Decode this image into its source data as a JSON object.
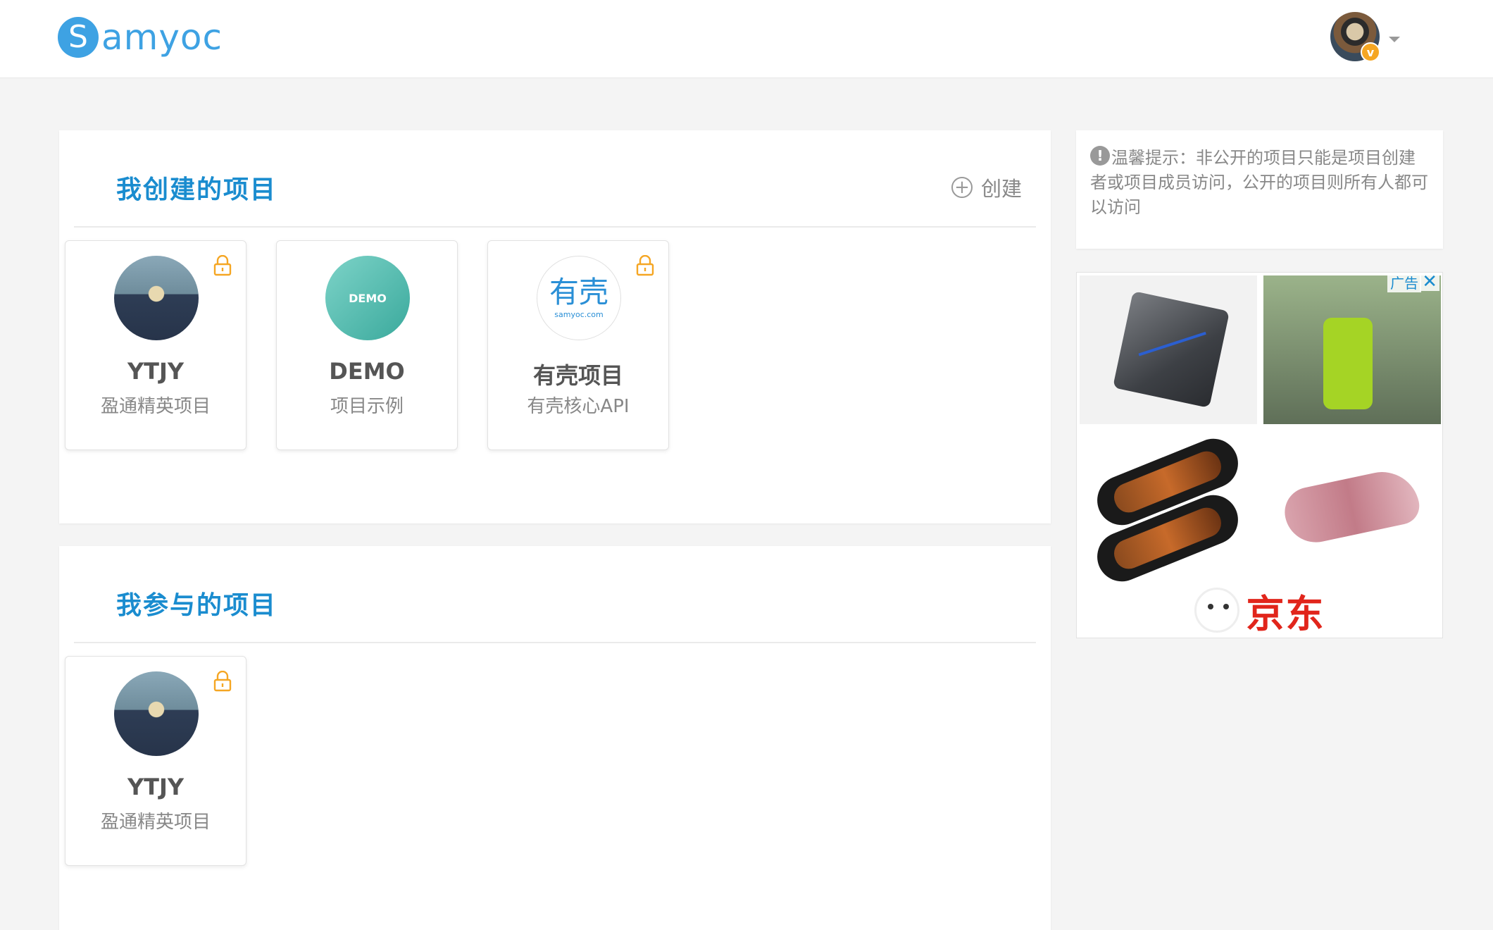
{
  "header": {
    "logo_mark": "S",
    "logo_text": "amyoc",
    "vip_badge": "v"
  },
  "created_section": {
    "title": "我创建的项目",
    "create_label": "创建",
    "projects": [
      {
        "name": "YTJY",
        "desc": "盈通精英项目",
        "locked": true
      },
      {
        "name": "DEMO",
        "desc": "项目示例",
        "locked": false,
        "cover_text": "DEMO"
      },
      {
        "name": "有壳项目",
        "desc": "有壳核心API",
        "locked": true,
        "cover_text": "有壳",
        "cover_url": "samyoc.com"
      }
    ]
  },
  "joined_section": {
    "title": "我参与的项目",
    "projects": [
      {
        "name": "YTJY",
        "desc": "盈通精英项目",
        "locked": true
      }
    ]
  },
  "tip": {
    "icon": "!",
    "text": "温馨提示：非公开的项目只能是项目创建者或项目成员访问，公开的项目则所有人都可以访问"
  },
  "ad": {
    "label": "广告",
    "close": "✕",
    "brand": "京东"
  },
  "colors": {
    "accent": "#1a8ccf",
    "logo": "#3ea2e3",
    "lock": "#f5a623",
    "jd_red": "#e1251b"
  }
}
